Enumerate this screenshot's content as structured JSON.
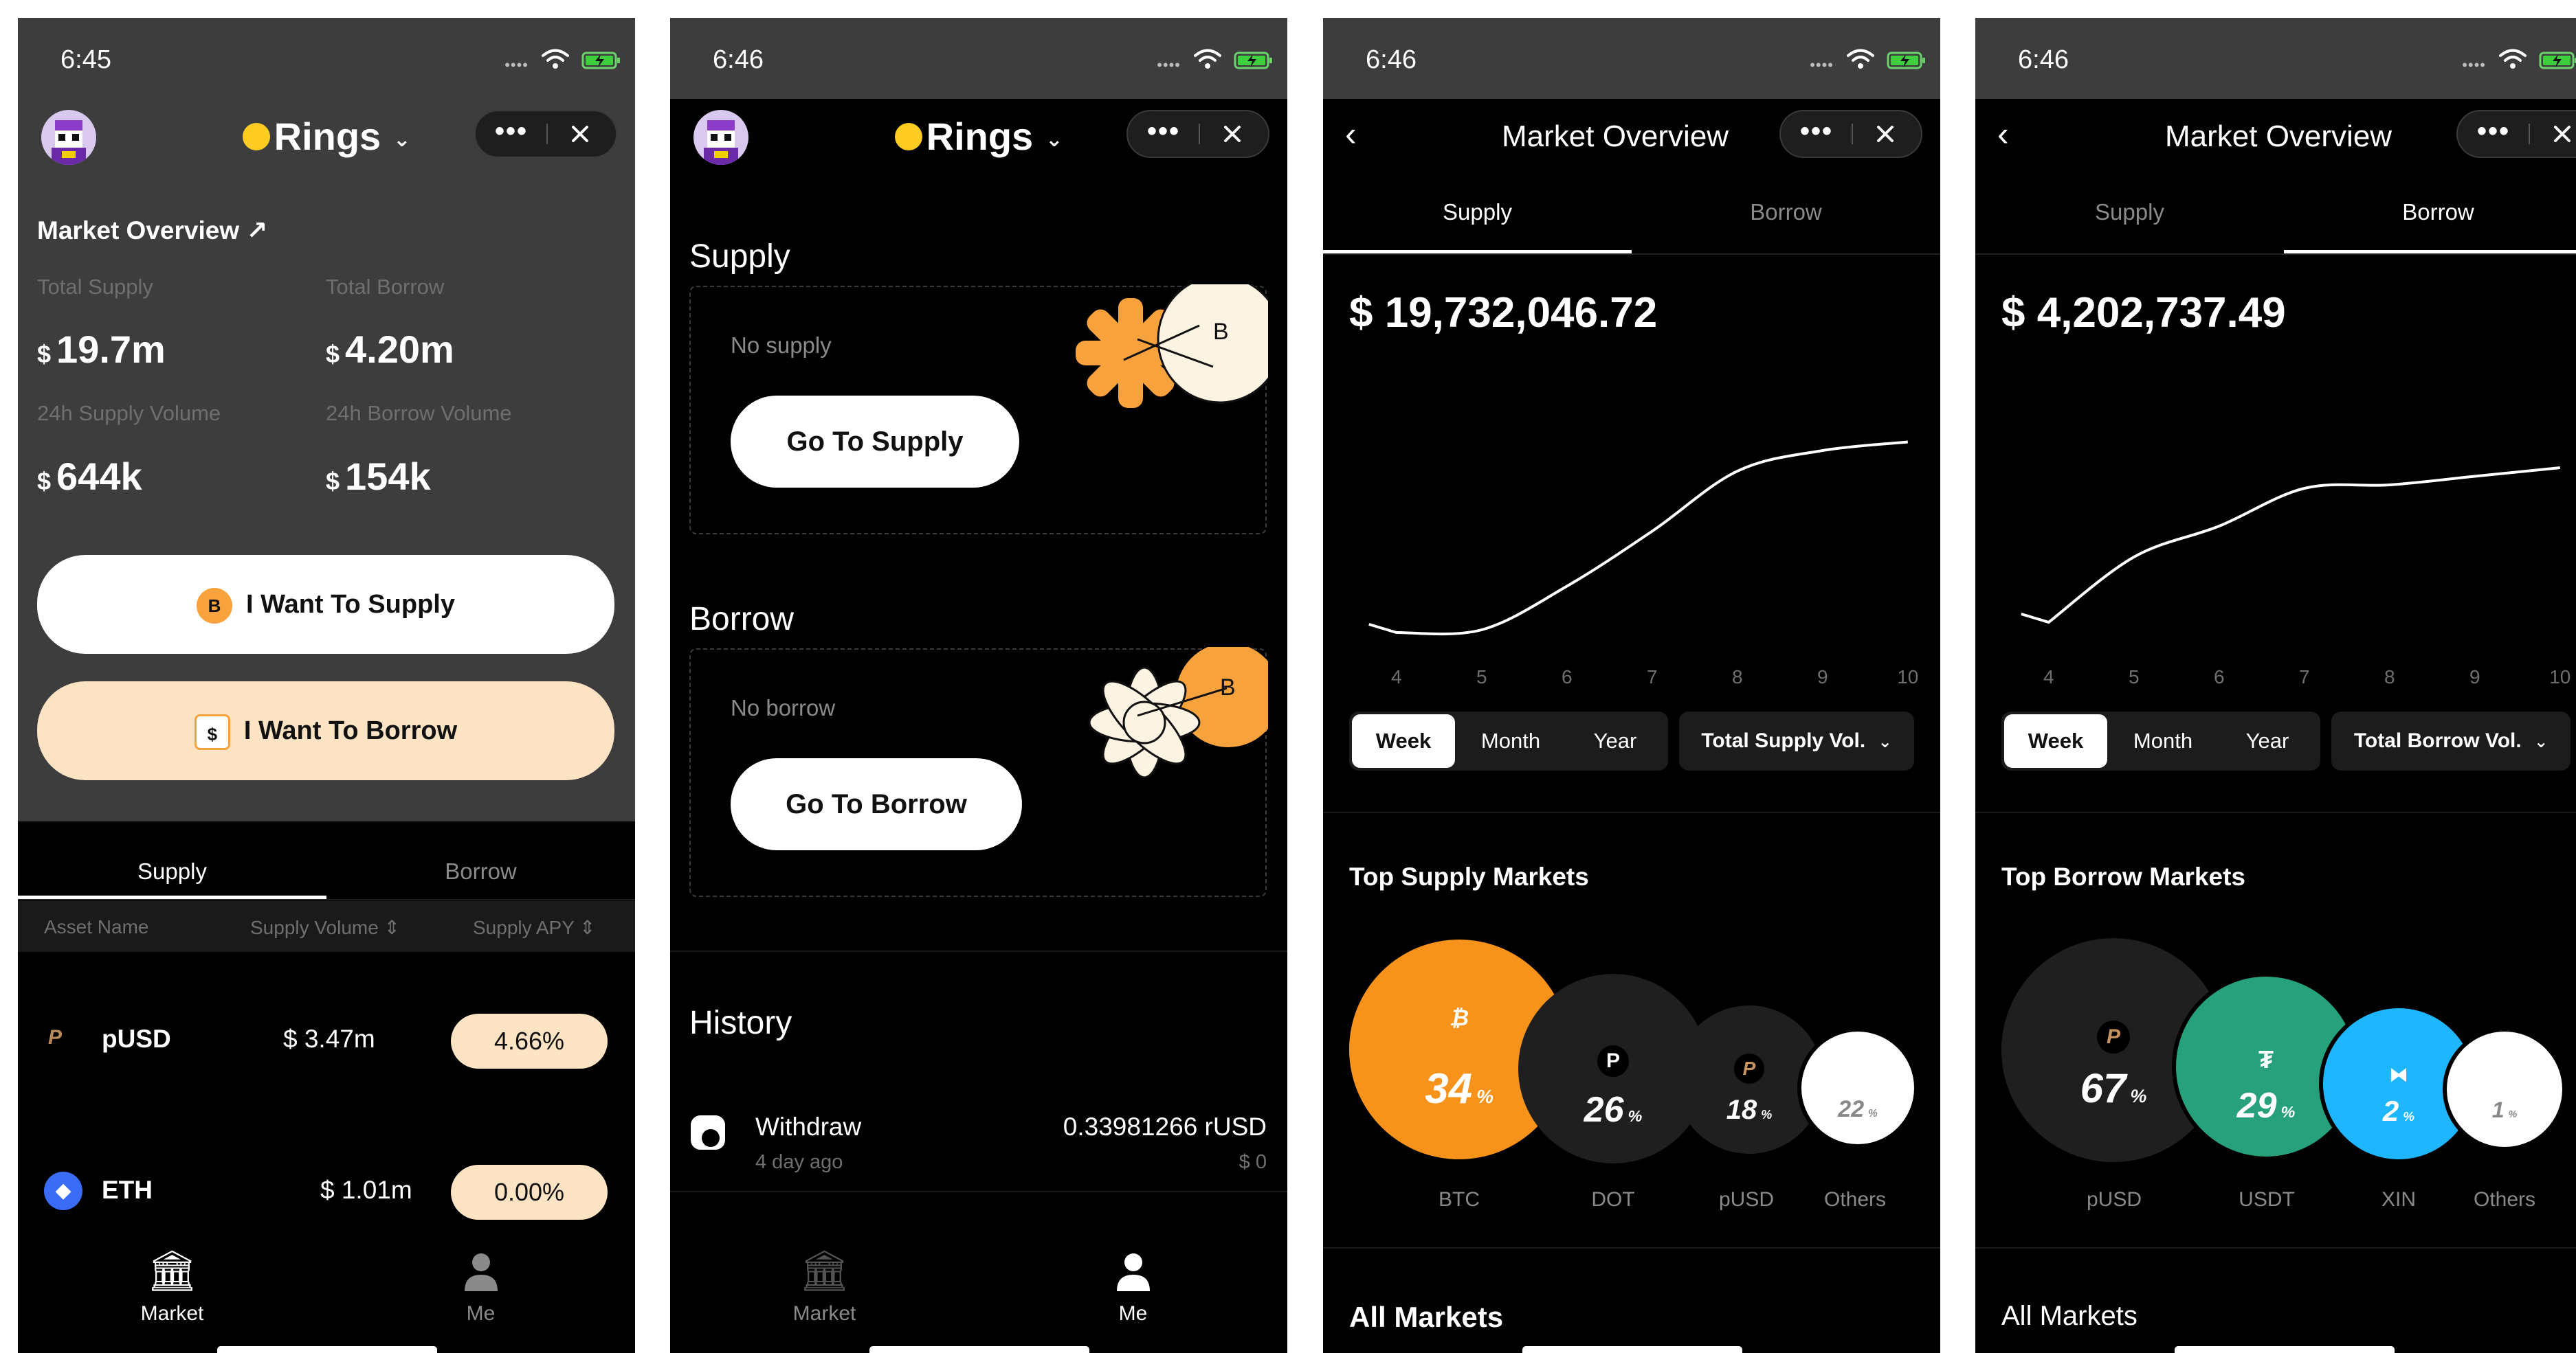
{
  "screens": [
    {
      "status_time": "6:45",
      "brand": "Rings",
      "market_overview_link": "Market Overview ↗",
      "stats": [
        {
          "label": "Total Supply",
          "currency": "$",
          "value": "19.7m"
        },
        {
          "label": "Total Borrow",
          "currency": "$",
          "value": "4.20m"
        },
        {
          "label": "24h Supply Volume",
          "currency": "$",
          "value": "644k"
        },
        {
          "label": "24h Borrow Volume",
          "currency": "$",
          "value": "154k"
        }
      ],
      "supply_button": "I Want To Supply",
      "borrow_button": "I Want To Borrow",
      "tabs": [
        "Supply",
        "Borrow"
      ],
      "columns": [
        "Asset Name",
        "Supply Volume",
        "Supply APY"
      ],
      "rows": [
        {
          "asset": "pUSD",
          "volume": "$ 3.47m",
          "apy": "4.66%"
        },
        {
          "asset": "ETH",
          "volume": "$ 1.01m",
          "apy": "0.00%"
        }
      ],
      "nav": [
        "Market",
        "Me"
      ]
    },
    {
      "status_time": "6:46",
      "brand": "Rings",
      "supply_title": "Supply",
      "no_supply": "No supply",
      "go_supply": "Go To Supply",
      "borrow_title": "Borrow",
      "no_borrow": "No borrow",
      "go_borrow": "Go To Borrow",
      "history_title": "History",
      "history": [
        {
          "type": "Withdraw",
          "time": "4 day ago",
          "amount": "0.33981266 rUSD",
          "usd": "$ 0"
        }
      ],
      "nav": [
        "Market",
        "Me"
      ]
    },
    {
      "status_time": "6:46",
      "title": "Market Overview",
      "tabs": [
        "Supply",
        "Borrow"
      ],
      "active_tab": "Supply",
      "total": "$ 19,732,046.72",
      "ranges": [
        "Week",
        "Month",
        "Year"
      ],
      "active_range": "Week",
      "metric_select": "Total Supply Vol.",
      "section_title": "Top Supply Markets",
      "bubbles": [
        {
          "name": "BTC",
          "pct": "34",
          "unit": "%",
          "color": "#f7931a"
        },
        {
          "name": "DOT",
          "pct": "26",
          "unit": "%",
          "color": "#1f1f1f"
        },
        {
          "name": "pUSD",
          "pct": "18",
          "unit": "%",
          "color": "#1f1f1f"
        },
        {
          "name": "Others",
          "pct": "22",
          "unit": "%",
          "color": "#ffffff"
        }
      ],
      "all_markets": "All Markets",
      "chart_data": {
        "type": "line",
        "x": [
          4,
          5,
          6,
          7,
          8,
          9,
          10
        ],
        "y": [
          0.7,
          0.78,
          2.05,
          3.65,
          5.4,
          6.0,
          6.25
        ],
        "xticks": [
          "4",
          "5",
          "6",
          "7",
          "8",
          "9",
          "10"
        ],
        "grid": false
      }
    },
    {
      "status_time": "6:46",
      "title": "Market Overview",
      "tabs": [
        "Supply",
        "Borrow"
      ],
      "active_tab": "Borrow",
      "total": "$ 4,202,737.49",
      "ranges": [
        "Week",
        "Month",
        "Year"
      ],
      "active_range": "Week",
      "metric_select": "Total Borrow Vol.",
      "section_title": "Top Borrow Markets",
      "bubbles": [
        {
          "name": "pUSD",
          "pct": "67",
          "unit": "%",
          "color": "#1f1f1f"
        },
        {
          "name": "USDT",
          "pct": "29",
          "unit": "%",
          "color": "#26a17b"
        },
        {
          "name": "XIN",
          "pct": "2",
          "unit": "%",
          "color": "#1db6ff"
        },
        {
          "name": "Others",
          "pct": "1",
          "unit": "%",
          "color": "#ffffff"
        }
      ],
      "all_markets": "All Markets",
      "chart_data": {
        "type": "line",
        "x": [
          4,
          5,
          6,
          7,
          8,
          9,
          10
        ],
        "y": [
          1.0,
          2.9,
          3.8,
          4.9,
          5.0,
          5.25,
          5.5
        ],
        "xticks": [
          "4",
          "5",
          "6",
          "7",
          "8",
          "9",
          "10"
        ],
        "grid": false
      }
    }
  ]
}
